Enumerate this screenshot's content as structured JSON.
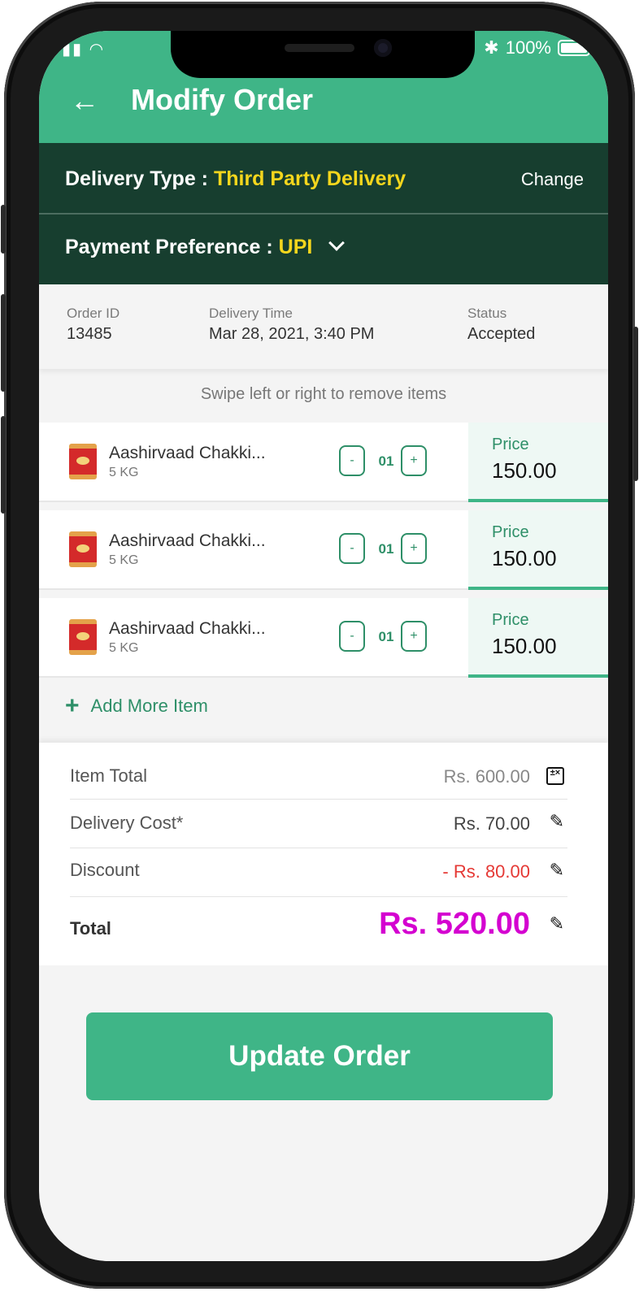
{
  "status_bar": {
    "signal": "▮▮",
    "wifi": "◠",
    "bluetooth": "✱",
    "battery": "100%"
  },
  "header": {
    "back_icon": "←",
    "title": "Modify Order",
    "color": "#3fb587"
  },
  "delivery": {
    "label": "Delivery Type :",
    "value": "Third Party Delivery",
    "change_label": "Change"
  },
  "payment": {
    "label": "Payment Preference :",
    "value": "UPI"
  },
  "order_info": {
    "order_id_label": "Order ID",
    "order_id": "13485",
    "delivery_time_label": "Delivery Time",
    "delivery_time": "Mar 28, 2021, 3:40 PM",
    "status_label": "Status",
    "status": "Accepted"
  },
  "swipe_hint": "Swipe left or right to remove items",
  "items": [
    {
      "name": "Aashirvaad Chakki...",
      "size": "5 KG",
      "minus": "-",
      "qty": "01",
      "plus": "+",
      "price_label": "Price",
      "price": "150.00"
    },
    {
      "name": "Aashirvaad Chakki...",
      "size": "5 KG",
      "minus": "-",
      "qty": "01",
      "plus": "+",
      "price_label": "Price",
      "price": "150.00"
    },
    {
      "name": "Aashirvaad Chakki...",
      "size": "5 KG",
      "minus": "-",
      "qty": "01",
      "plus": "+",
      "price_label": "Price",
      "price": "150.00"
    }
  ],
  "add_more": {
    "icon": "+",
    "label": "Add More Item"
  },
  "summary": {
    "item_total_label": "Item Total",
    "item_total": "Rs. 600.00",
    "delivery_cost_label": "Delivery Cost*",
    "delivery_cost": "Rs. 70.00",
    "discount_label": "Discount",
    "discount": "- Rs. 80.00",
    "total_label": "Total",
    "total": "Rs. 520.00",
    "edit_icon": "✎",
    "calc_icon": "±×"
  },
  "update_button": "Update Order",
  "colors": {
    "primary": "#3fb587",
    "dark": "#173e2f",
    "highlight": "#f5d61d",
    "discount": "#e53935",
    "total": "#d400d0"
  }
}
